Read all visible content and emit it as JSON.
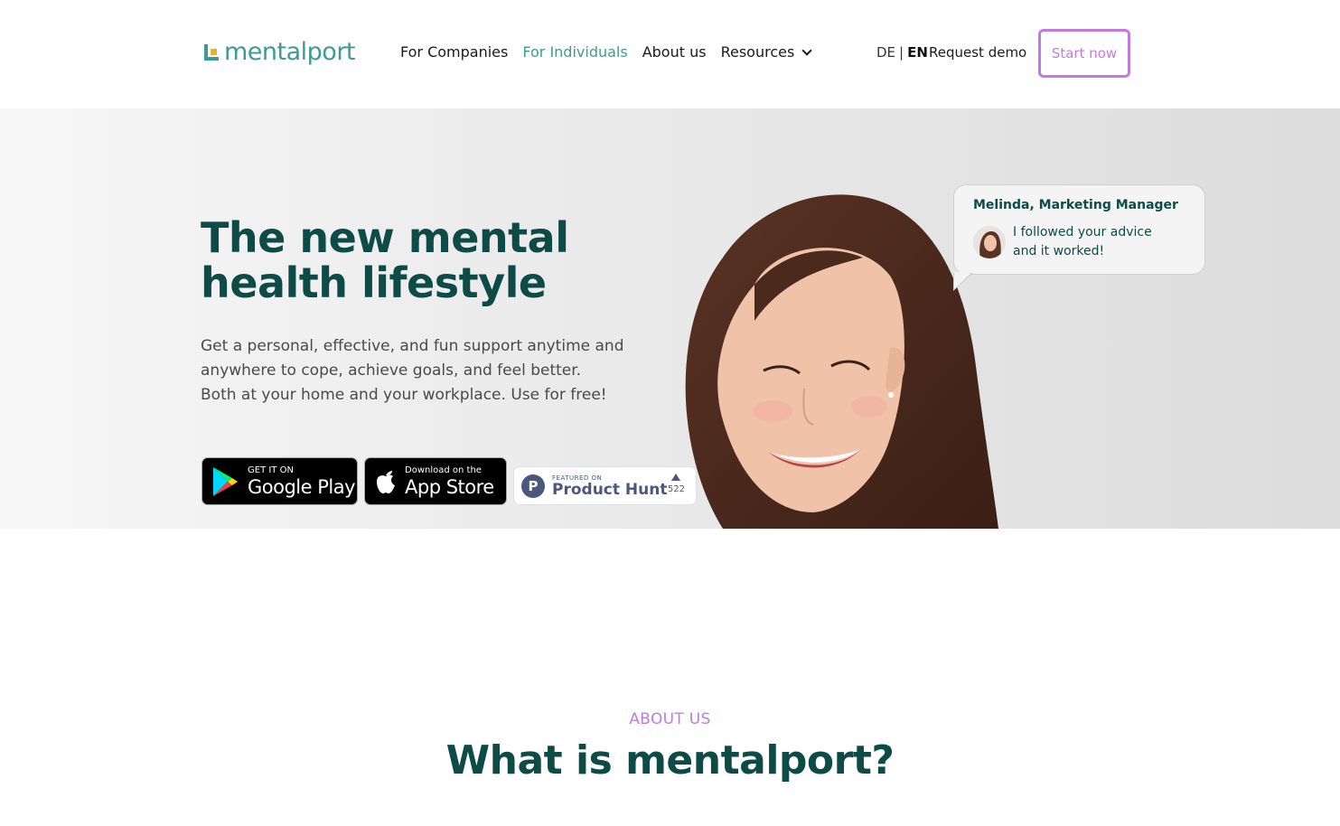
{
  "header": {
    "logo_text": "mentalport",
    "nav": [
      {
        "label": "For Companies",
        "active": false
      },
      {
        "label": "For Individuals",
        "active": true
      },
      {
        "label": "About us",
        "active": false
      },
      {
        "label": "Resources",
        "active": false,
        "has_dropdown": true
      }
    ],
    "lang_de": "DE",
    "lang_sep": "|",
    "lang_en": "EN",
    "request_demo": "Request demo",
    "start_now": "Start now"
  },
  "hero": {
    "title": "The new mental health lifestyle",
    "desc_lines": [
      "Get a personal, effective, and fun support anytime and",
      "anywhere to cope, achieve goals, and feel better.",
      "Both at your home and your workplace. Use for free!"
    ],
    "google_play": {
      "small": "GET IT ON",
      "big": "Google Play"
    },
    "app_store": {
      "small": "Download on the",
      "big": "App Store"
    },
    "product_hunt": {
      "small": "FEATURED ON",
      "big": "Product Hunt",
      "votes": "522",
      "letter": "P"
    }
  },
  "testimonial": {
    "name": "Melinda, Marketing Manager",
    "lines": [
      "I followed your advice",
      "and it worked!"
    ]
  },
  "about": {
    "eyebrow": "ABOUT US",
    "title": "What is mentalport?"
  },
  "colors": {
    "brand_teal": "#3e9a94",
    "dark_teal": "#0e4b47",
    "accent_purple": "#c27ae0"
  }
}
